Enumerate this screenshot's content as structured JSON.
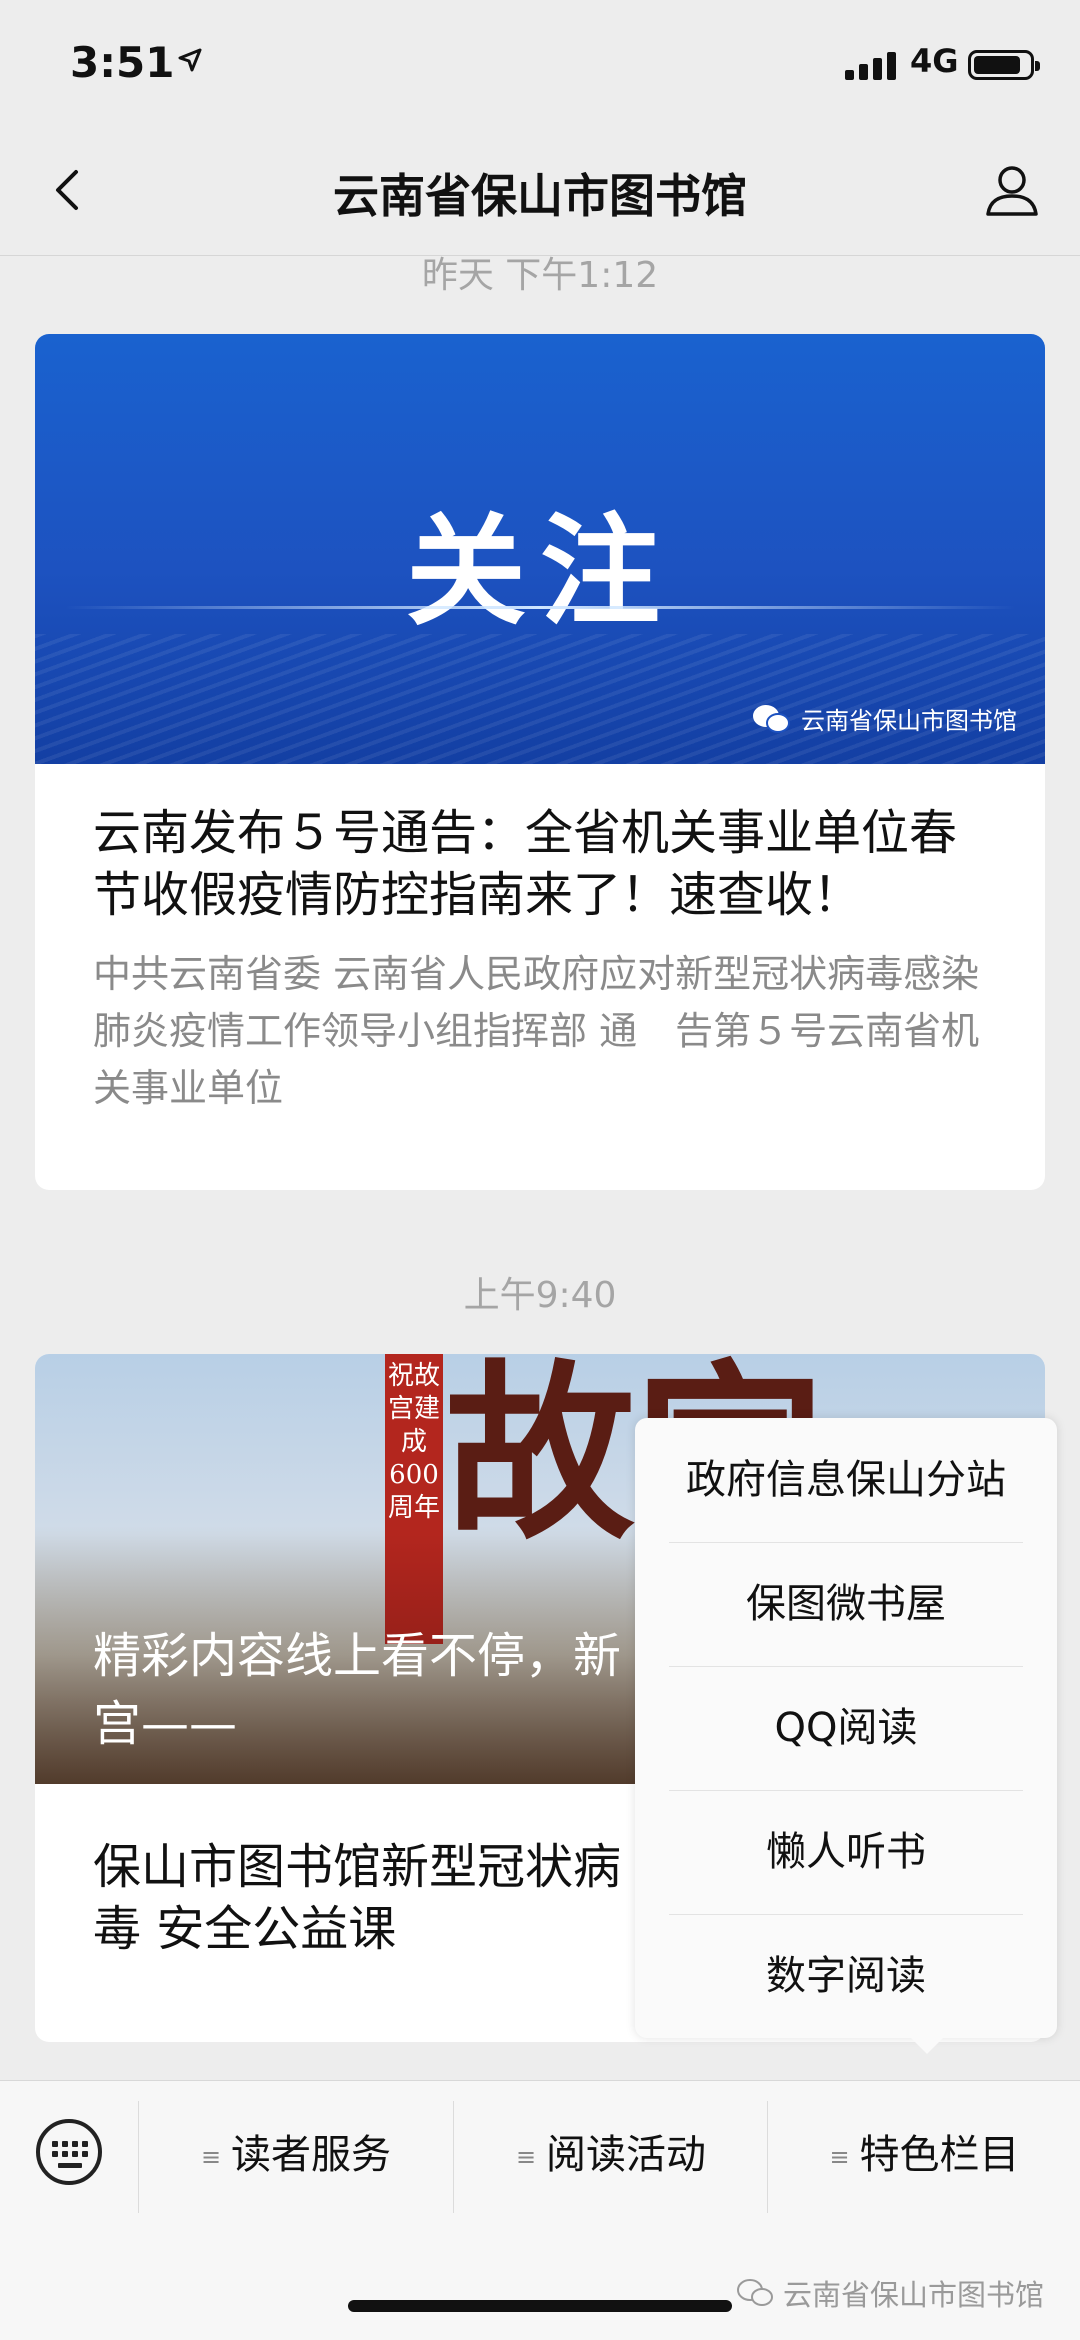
{
  "status_bar": {
    "time": "3:51",
    "network": "4G"
  },
  "nav": {
    "title": "云南省保山市图书馆"
  },
  "messages": [
    {
      "timestamp": "昨天 下午1:12",
      "banner_text": "关注",
      "banner_watermark": "云南省保山市图书馆",
      "headline": "云南发布５号通告：全省机关事业单位春节收假疫情防控指南来了！速查收！",
      "digest": "中共云南省委 云南省人民政府应对新型冠状病毒感染肺炎疫情工作领导小组指挥部 通　告第５号云南省机关事业单位"
    },
    {
      "timestamp": "上午9:40",
      "ribbon_text": "祝故宫建成600周年",
      "calligraphy": "故宫",
      "photo_title": "精彩内容线上看不停，新 之——《你好 故宫——",
      "headline": "保山市图书馆新型冠状病毒 安全公益课"
    }
  ],
  "menu": {
    "items": [
      "政府信息保山分站",
      "保图微书屋",
      "QQ阅读",
      "懒人听书",
      "数字阅读"
    ]
  },
  "bottom_bar": {
    "tabs": [
      "读者服务",
      "阅读活动",
      "特色栏目"
    ]
  },
  "watermark": "云南省保山市图书馆"
}
